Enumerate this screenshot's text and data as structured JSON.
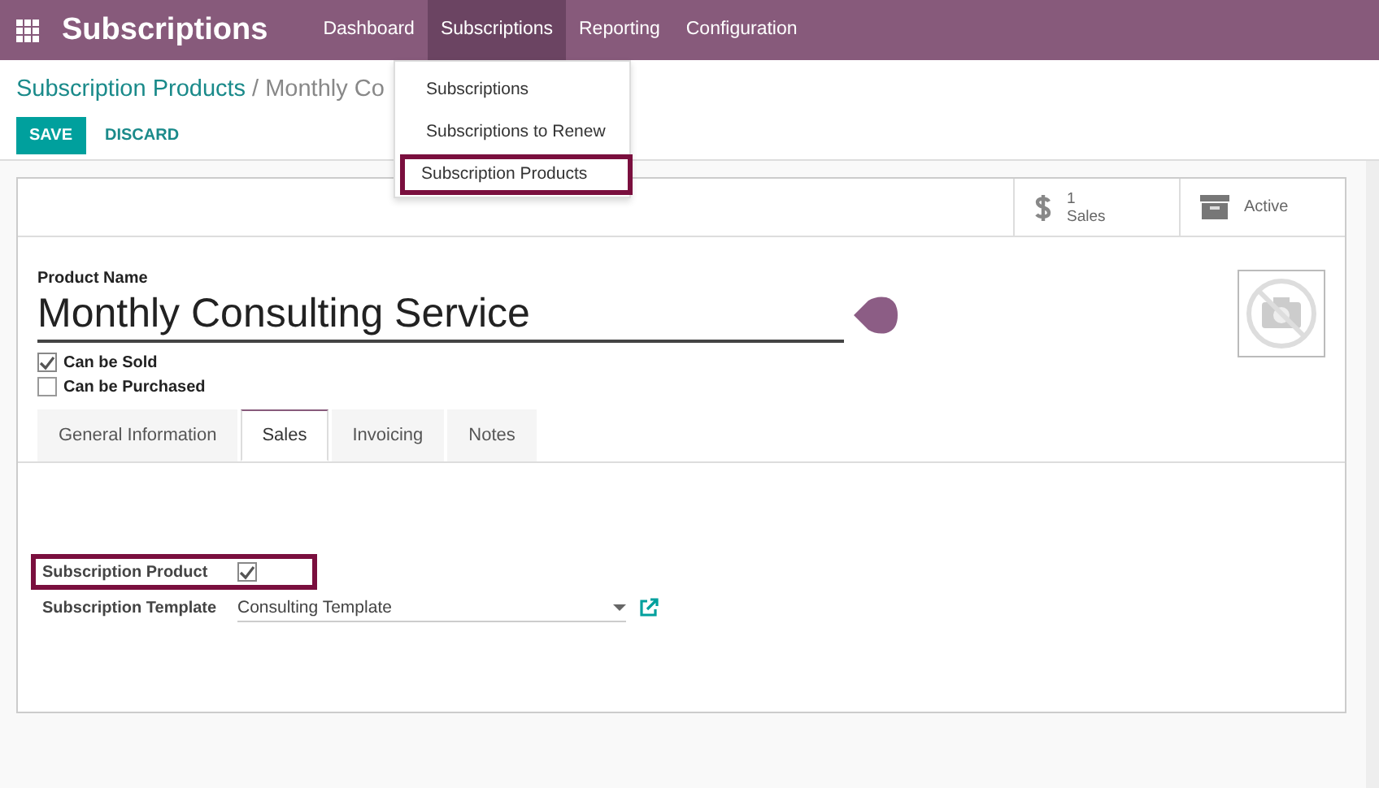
{
  "navbar": {
    "app_title": "Subscriptions",
    "menus": [
      {
        "label": "Dashboard",
        "selected": false
      },
      {
        "label": "Subscriptions",
        "selected": true
      },
      {
        "label": "Reporting",
        "selected": false
      },
      {
        "label": "Configuration",
        "selected": false
      }
    ]
  },
  "dropdown": {
    "items": [
      {
        "label": "Subscriptions",
        "highlighted": false
      },
      {
        "label": "Subscriptions to Renew",
        "highlighted": false
      },
      {
        "label": "Subscription Products",
        "highlighted": true
      }
    ]
  },
  "breadcrumb": {
    "parent": "Subscription Products",
    "separator": "/",
    "current": "Monthly Co"
  },
  "buttons": {
    "save": "SAVE",
    "discard": "DISCARD"
  },
  "smart_buttons": [
    {
      "kind": "stat",
      "value": "1",
      "label": "Sales"
    },
    {
      "kind": "toggle",
      "label": "Active"
    }
  ],
  "form": {
    "name_label": "Product Name",
    "name": "Monthly Consulting Service",
    "checkboxes": [
      {
        "label": "Can be Sold",
        "checked": true
      },
      {
        "label": "Can be Purchased",
        "checked": false
      }
    ]
  },
  "tabs": [
    {
      "label": "General Information",
      "selected": false
    },
    {
      "label": "Sales",
      "selected": true
    },
    {
      "label": "Invoicing",
      "selected": false
    },
    {
      "label": "Notes",
      "selected": false
    }
  ],
  "fields": [
    {
      "kind": "checkbox",
      "label": "Subscription Product",
      "checked": true,
      "highlighted": true
    },
    {
      "kind": "select",
      "label": "Subscription Template",
      "value": "Consulting Template",
      "highlighted": false
    }
  ]
}
